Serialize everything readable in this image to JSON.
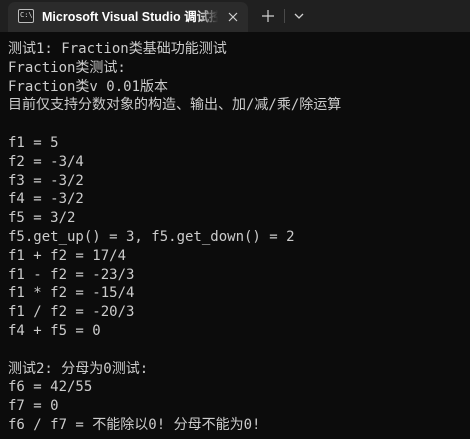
{
  "tab": {
    "title": "Microsoft Visual Studio 调试控制台",
    "icon": "console-app-icon",
    "icon_text": "C:\\",
    "close_icon": "close-icon",
    "new_tab_icon": "plus-icon",
    "dropdown_icon": "chevron-down-icon"
  },
  "colors": {
    "titlebar_bg": "#202020",
    "tab_bg": "#2b2b2b",
    "console_bg": "#0c0c0c",
    "console_text": "#cccccc"
  },
  "console": {
    "lines": [
      "测试1: Fraction类基础功能测试",
      "Fraction类测试:",
      "Fraction类v 0.01版本",
      "目前仅支持分数对象的构造、输出、加/减/乘/除运算",
      "",
      "f1 = 5",
      "f2 = -3/4",
      "f3 = -3/2",
      "f4 = -3/2",
      "f5 = 3/2",
      "f5.get_up() = 3, f5.get_down() = 2",
      "f1 + f2 = 17/4",
      "f1 - f2 = -23/3",
      "f1 * f2 = -15/4",
      "f1 / f2 = -20/3",
      "f4 + f5 = 0",
      "",
      "测试2: 分母为0测试:",
      "f6 = 42/55",
      "f7 = 0",
      "f6 / f7 = 不能除以0! 分母不能为0!"
    ]
  }
}
